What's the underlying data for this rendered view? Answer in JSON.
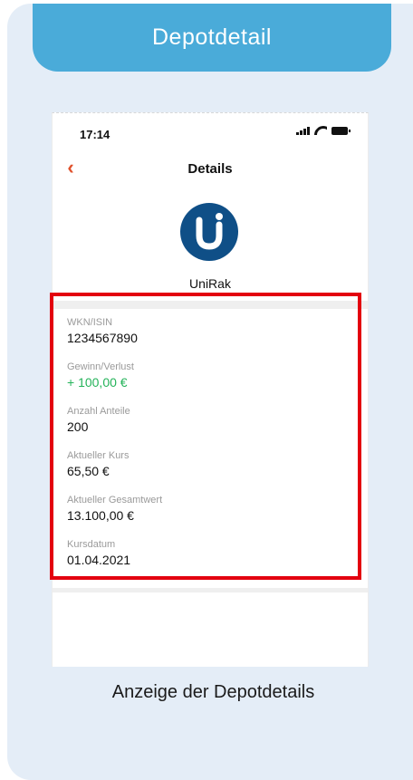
{
  "header": {
    "title": "Depotdetail"
  },
  "phone": {
    "status_time": "17:14",
    "nav": {
      "back_icon": "chevron-left-icon",
      "back_glyph": "‹",
      "title": "Details"
    },
    "fund": {
      "name": "UniRak",
      "logo": "union-investment-logo",
      "logo_color": "#0f4f87"
    },
    "details": [
      {
        "label": "WKN/ISIN",
        "value": "1234567890"
      },
      {
        "label": "Gewinn/Verlust",
        "value": "+ 100,00 €",
        "color": "#25b35a"
      },
      {
        "label": "Anzahl Anteile",
        "value": "200"
      },
      {
        "label": "Aktueller Kurs",
        "value": "65,50 €"
      },
      {
        "label": "Aktueller Gesamtwert",
        "value": "13.100,00 €"
      },
      {
        "label": "Kursdatum",
        "value": "01.04.2021"
      }
    ]
  },
  "caption": "Anzeige der Depotdetails",
  "colors": {
    "header": "#4aabd9",
    "background": "#e4edf7",
    "highlight": "#e3000f",
    "accent": "#e0522d"
  }
}
